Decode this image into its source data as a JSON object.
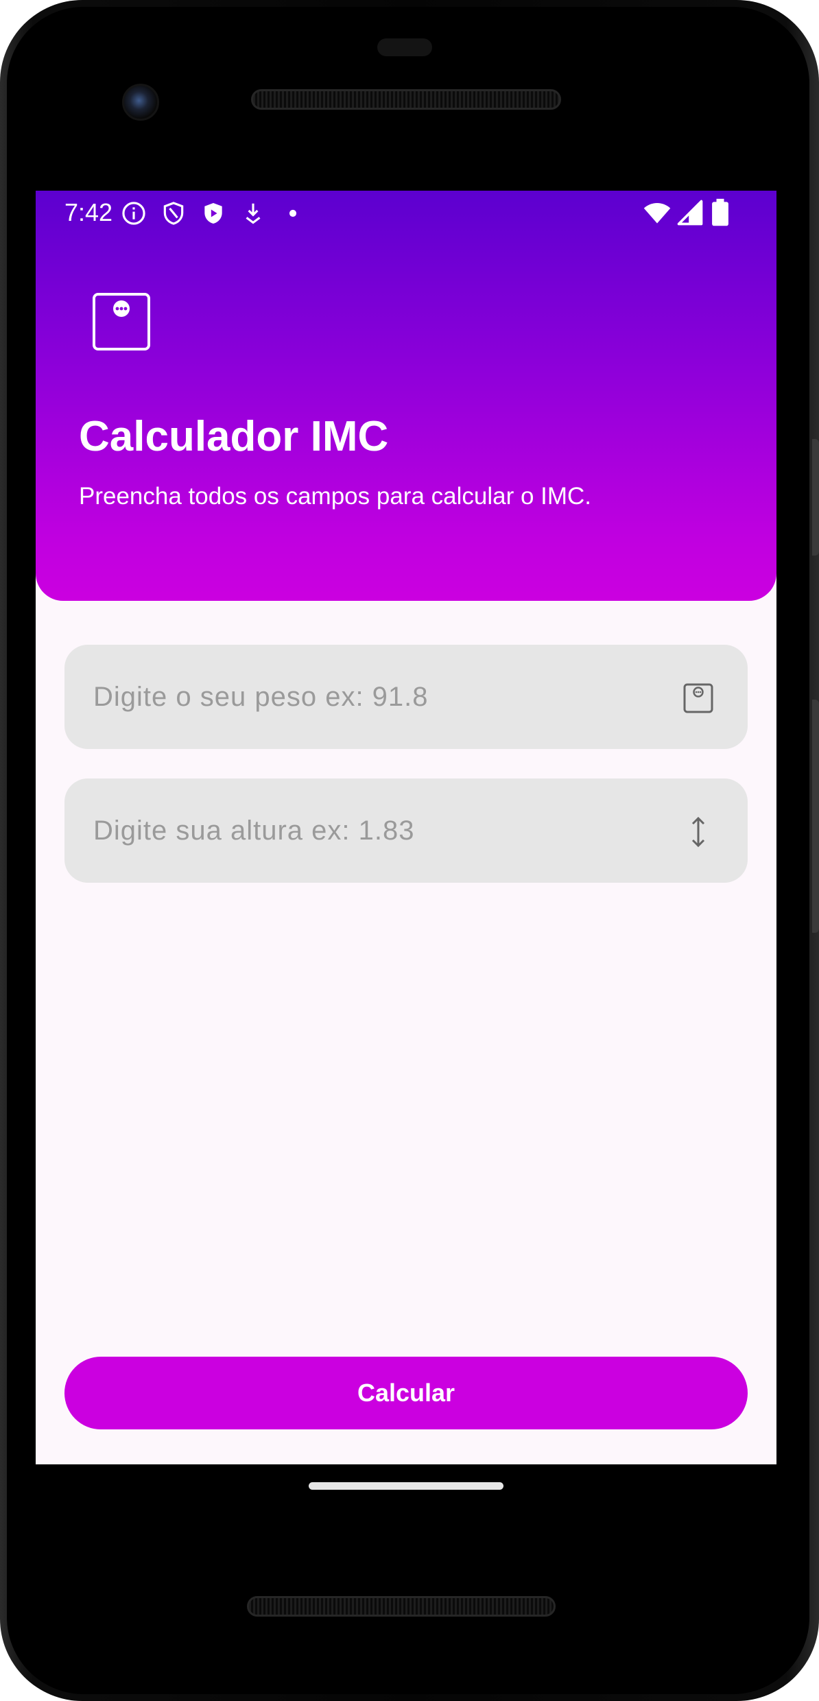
{
  "status_bar": {
    "time": "7:42"
  },
  "header": {
    "title": "Calculador IMC",
    "subtitle": "Preencha todos os campos para calcular o IMC.",
    "icon": "weight-scale-icon"
  },
  "form": {
    "weight_field": {
      "value": "",
      "placeholder": "Digite o seu peso ex: 91.8",
      "icon": "scale-icon"
    },
    "height_field": {
      "value": "",
      "placeholder": "Digite sua altura ex: 1.83",
      "icon": "vertical-arrows-icon"
    }
  },
  "actions": {
    "calculate_label": "Calcular"
  },
  "colors": {
    "header_top": "#5c00cf",
    "header_bottom": "#cb00e0",
    "accent": "#cb00e0",
    "field_background": "#e6e6e6",
    "screen_background": "#fdf7fc"
  }
}
